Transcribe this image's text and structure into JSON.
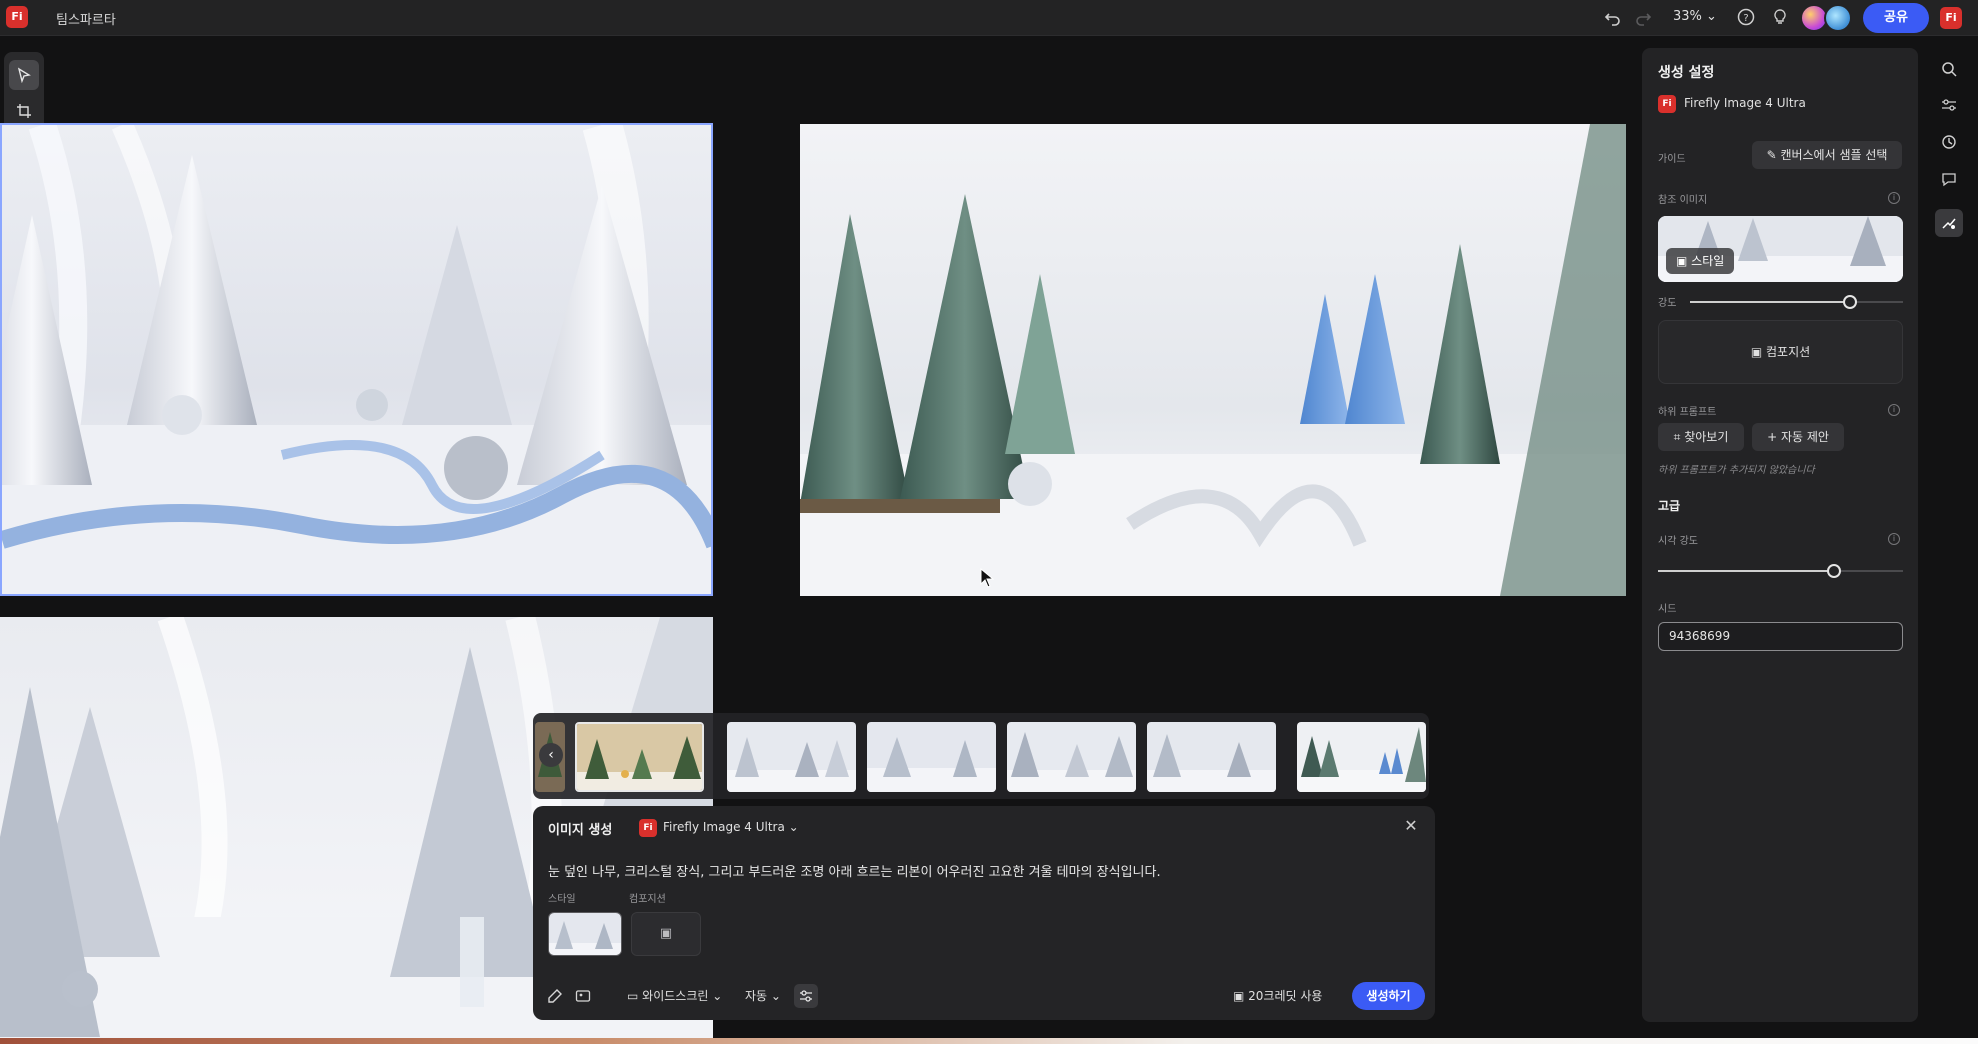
{
  "app": {
    "logo_text": "Fi",
    "document_title": "팀스파르타",
    "zoom": "33%",
    "share_label": "공유",
    "user_logo": "Fi"
  },
  "colors": {
    "accent": "#3b5bf5",
    "brand": "#d9302c",
    "selection": "#8aa6ff"
  },
  "left_tools": [
    "select-tool",
    "crop-tool",
    "text-tool",
    "shape-tool",
    "generate-tool"
  ],
  "panel": {
    "title": "생성 설정",
    "model_logo": "Fi",
    "model": "Firefly Image 4 Ultra",
    "guide_label": "가이드",
    "sample_button": "캔버스에서 샘플 선택",
    "ref_label": "참조 이미지",
    "style_chip": "스타일",
    "strength_label": "강도",
    "strength_value": 0.75,
    "composition_button": "컴포지션",
    "negative_label": "하위 프롬프트",
    "browse_button": "찾아보기",
    "auto_button": "자동 제안",
    "negative_note": "하위 프롬프트가 추가되지 않았습니다",
    "advanced_title": "고급",
    "visual_label": "시각 강도",
    "visual_value": 0.72,
    "seed_label": "시드",
    "seed_value": "94368699"
  },
  "generate": {
    "title": "이미지 생성",
    "model_logo": "Fi",
    "model": "Firefly Image 4 Ultra",
    "prompt": "눈 덮인 나무, 크리스털 장식, 그리고 부드러운 조명 아래 흐르는 리본이 어우러진 고요한 겨울 테마의 장식입니다.",
    "style_label": "스타일",
    "composition_label": "컴포지션",
    "aspect_label": "와이드스크린",
    "mode_label": "자동",
    "credits": "20크레딧 사용",
    "generate_button": "생성하기"
  }
}
